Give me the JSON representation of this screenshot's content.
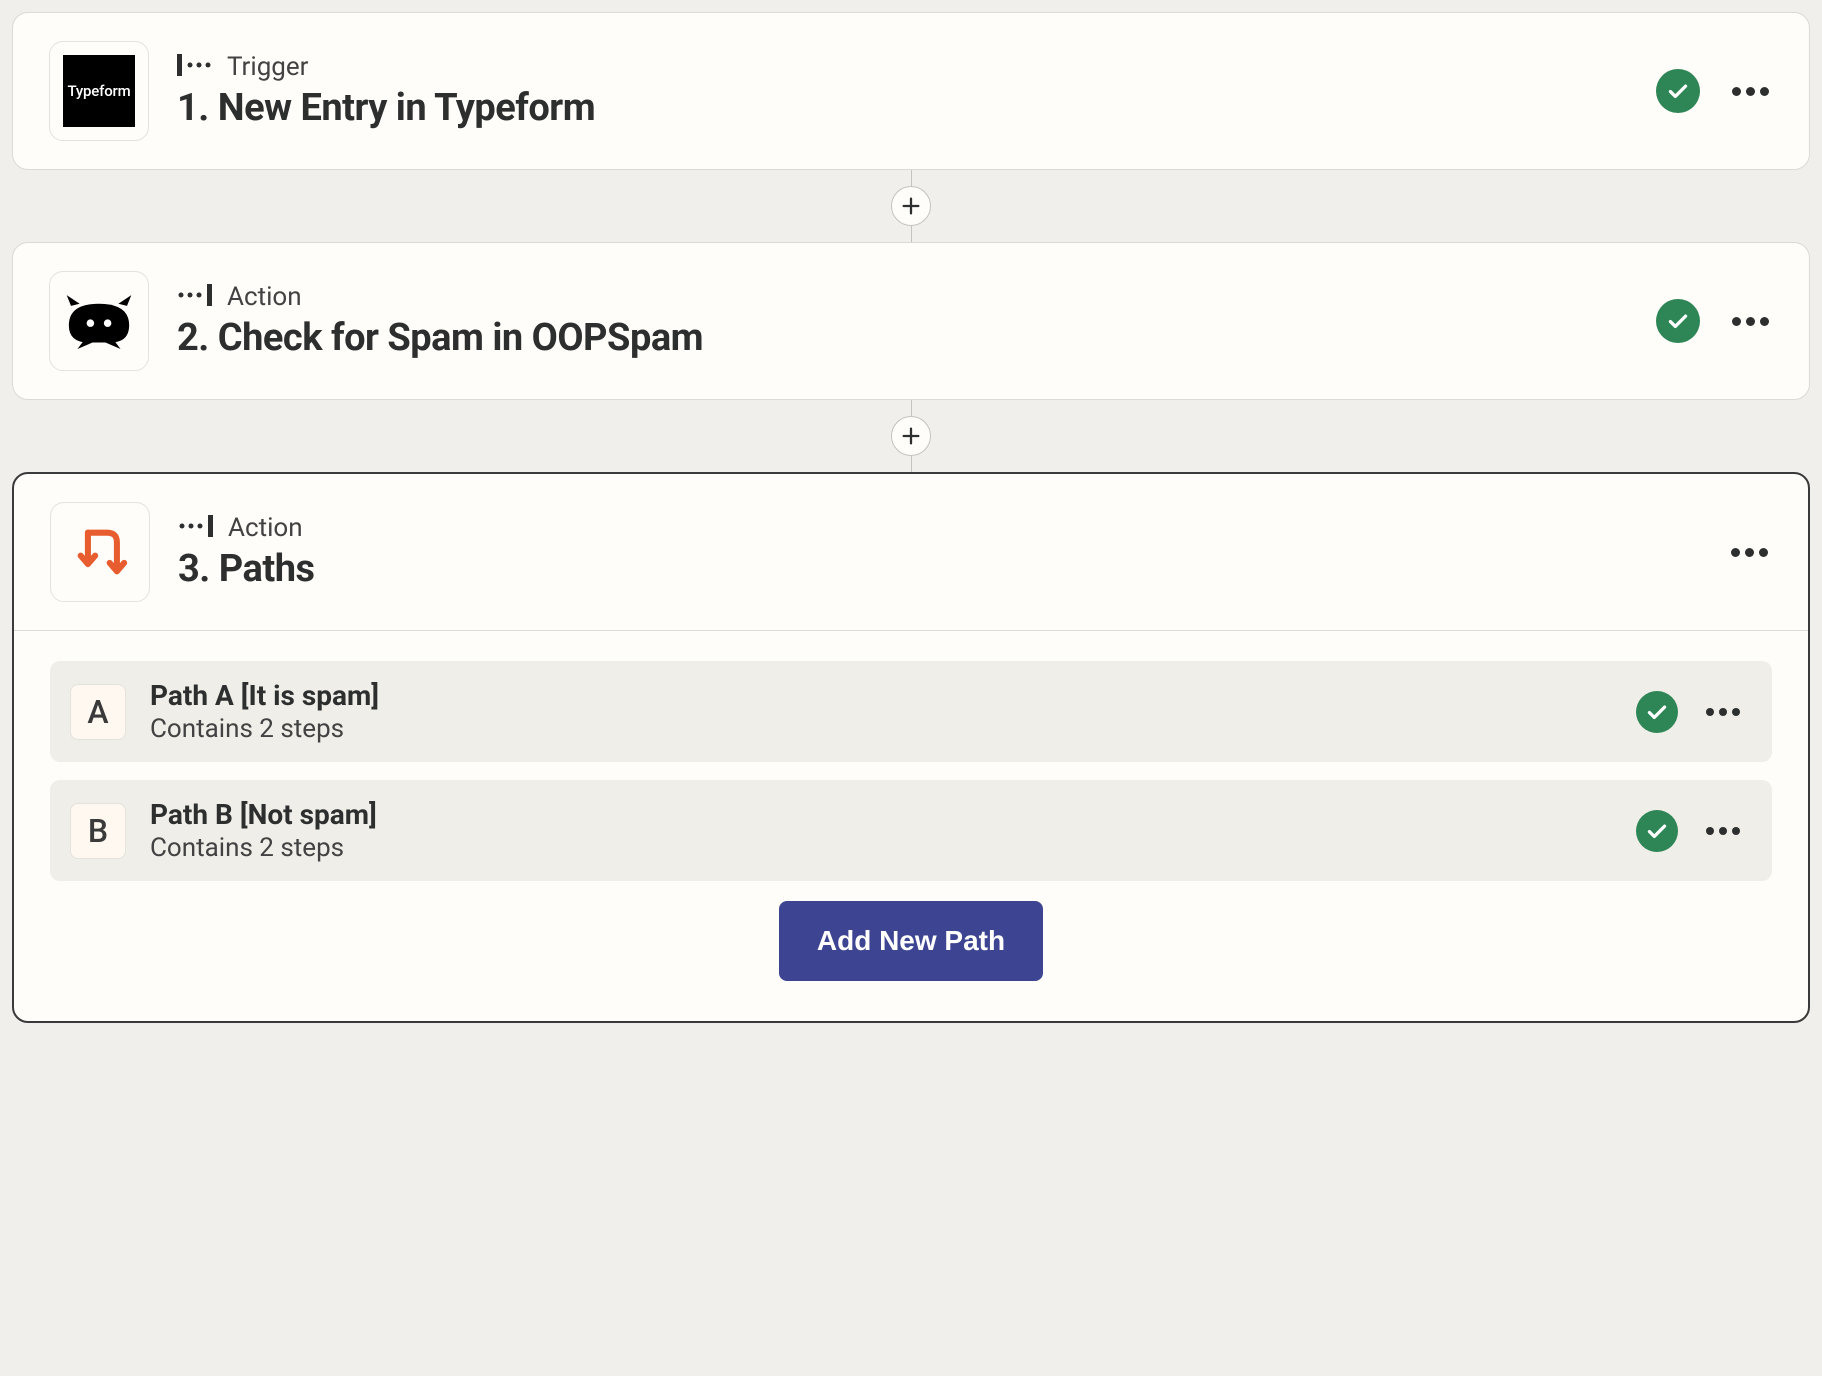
{
  "steps": [
    {
      "type_label": "Trigger",
      "title": "1. New Entry in Typeform",
      "icon": "typeform",
      "has_status": true
    },
    {
      "type_label": "Action",
      "title": "2. Check for Spam in OOPSpam",
      "icon": "oopspam",
      "has_status": true
    },
    {
      "type_label": "Action",
      "title": "3. Paths",
      "icon": "paths",
      "has_status": false,
      "selected": true
    }
  ],
  "typeform_logo_text": "Typeform",
  "paths": [
    {
      "letter": "A",
      "name": "Path A [It is spam]",
      "subtitle": "Contains 2 steps"
    },
    {
      "letter": "B",
      "name": "Path B [Not spam]",
      "subtitle": "Contains 2 steps"
    }
  ],
  "add_path_label": "Add New Path"
}
